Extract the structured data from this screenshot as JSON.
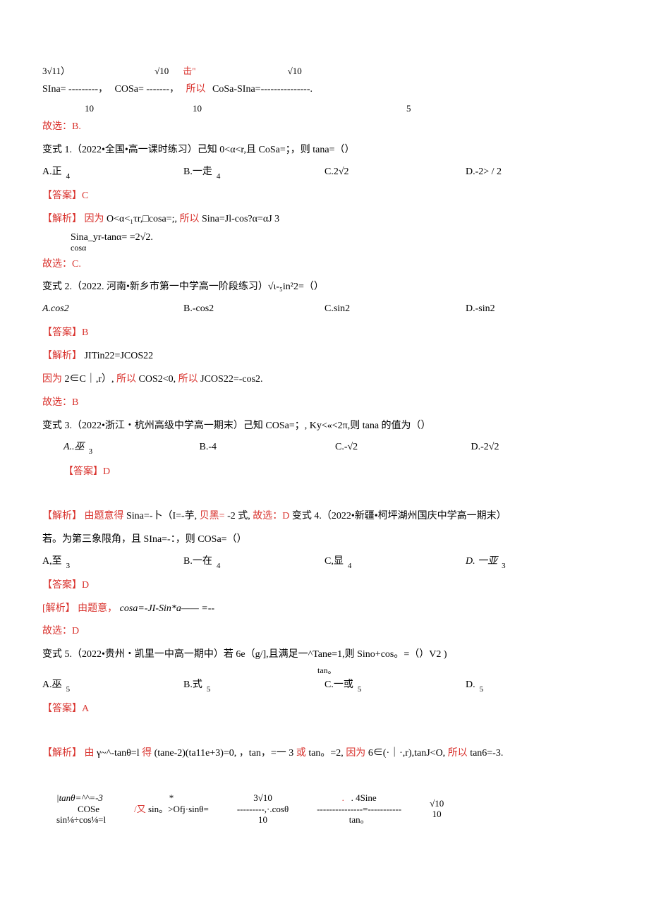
{
  "topline": {
    "part1_top": "3√11）",
    "part1_bot": "10",
    "part1_mid": "SIna= ---------，",
    "part2_top": "√10",
    "part2_bot": "10",
    "part2_mid": "COSa= -------，",
    "part3_top_red": "击\"",
    "part3_mid": "所以",
    "part4_top": "√10",
    "part4_bot": "5",
    "part4_mid": "CoSa-SIna=---------------."
  },
  "block0": {
    "choose": "故选：B.",
    "variant": "变式 1.（2022•全国•高一课时练习）己知 0<α<r,且 CoSa=；，则 tana=（）",
    "opts": {
      "a": "A.正",
      "a_sub": "4",
      "b": "B.一走",
      "b_sub": "4",
      "c": "C.2√2",
      "d": "D.-2> / 2"
    },
    "answer": "【答案】C",
    "analysis_label": "【解析】",
    "analysis_black1": "因为",
    "analysis_black2": "O<α<₁τr,□cosa=;,",
    "analysis_red2": "所以",
    "analysis_black3": "Sina=Jl-cos?α=αJ                          3",
    "indent_line": "Sina_yr-tanα=     =2√2.",
    "indent_line2": "cosα",
    "choose2": "故选：C."
  },
  "block1": {
    "variant": "变式 2.（2022. 河南•新乡市第一中学高一阶段练习）√ι-₅in²2=（）",
    "opts": {
      "a": "A.cos2",
      "b": "B.-cos2",
      "c": "C.sin2",
      "d": "D.-sin2"
    },
    "answer": "【答案】B",
    "analysis_label": "【解析】",
    "analysis_black": "JITin22=JCOS22",
    "line_red1": "因为",
    "line_black1": "2∈C｜,r）,",
    "line_red2": "所以",
    "line_black2": "COS2<0,",
    "line_red3": "所以",
    "line_black3": "JCOS22=-cos2.",
    "choose": "故选：B"
  },
  "block2": {
    "variant": "变式 3.（2022•浙江・杭州高级中学高一期末）己知 COSa=；, Ky<«<2π,则 tana 的值为（）",
    "opts": {
      "a": "A..巫",
      "a_sub": "3",
      "b": "B.-4",
      "c": "C.-√2",
      "d": "D.-2√2"
    },
    "answer": "【答案】D"
  },
  "block3": {
    "analysis_label": "【解析】",
    "analysis_red2": "由题意得",
    "analysis_black1": "Sina=-卜（I=-芋,",
    "analysis_red3": "贝黑=",
    "analysis_black2": "-2 式,",
    "analysis_red4": "故选：D",
    "analysis_black3": "变式 4.（2022•新疆•柯坪湖州国庆中学高一期末）",
    "line2": "若。为第三象限角，且 SIna=-：，则 COSa=（）",
    "opts": {
      "a": "A,至",
      "a_sub": "3",
      "b": "B.一在",
      "b_sub": "4",
      "c": "C,显",
      "c_sub": "4",
      "d": "D. 一亚",
      "d_sub": "3"
    },
    "answer": "【答案】D",
    "an2_label": "[解析】",
    "an2_red": "由题意，",
    "an2_black": "cosa=-JI-Sin*a——                           =--",
    "choose": "故选：D"
  },
  "block4": {
    "variant_pre": "变式 5.（2022•贵州・凯里一中高一期中）若 6e（g/],且满足一^Tane=1,则 Sino+cos。=（）V2          )",
    "variant_sub": "tan。",
    "opts": {
      "a": "A.巫",
      "a_sub": "5",
      "b": "B.式",
      "b_sub": "5",
      "c": "C.一或",
      "c_sub": "5",
      "d": "D.",
      "d_sub": "5"
    },
    "answer": "【答案】A",
    "analysis_label": "【解析】",
    "an_red1": "由",
    "an_black1": "γ~^-tanθ=l",
    "an_red2": "得",
    "an_black2": "(tane-2)(ta11e+3)=0, ，tan，=一 3",
    "an_red3": "或",
    "an_black3": "tan。=2,",
    "an_red4": "因为",
    "an_black4": "6∈(·｜·,r),tanJ<O,",
    "an_red5": "所以",
    "an_black5": "tan6=-3."
  },
  "bottom": {
    "col1_a": "|tanθ=^^=-3",
    "col1_b": "COSe",
    "col1_c": "sin⅛÷cos⅛=l",
    "col2_a": "*",
    "col2_b": "/又",
    "col2_b2": "sin。>Ofj·sinθ=",
    "col3_a": "3√10",
    "col3_b": "---------,·.cosθ",
    "col3_c": "10",
    "col4_a": ".    4Sine",
    "col4_b": "---------------=-----------",
    "col4_c": "tan。",
    "col5_a": "√10",
    "col5_b": "",
    "col5_c": "10"
  }
}
